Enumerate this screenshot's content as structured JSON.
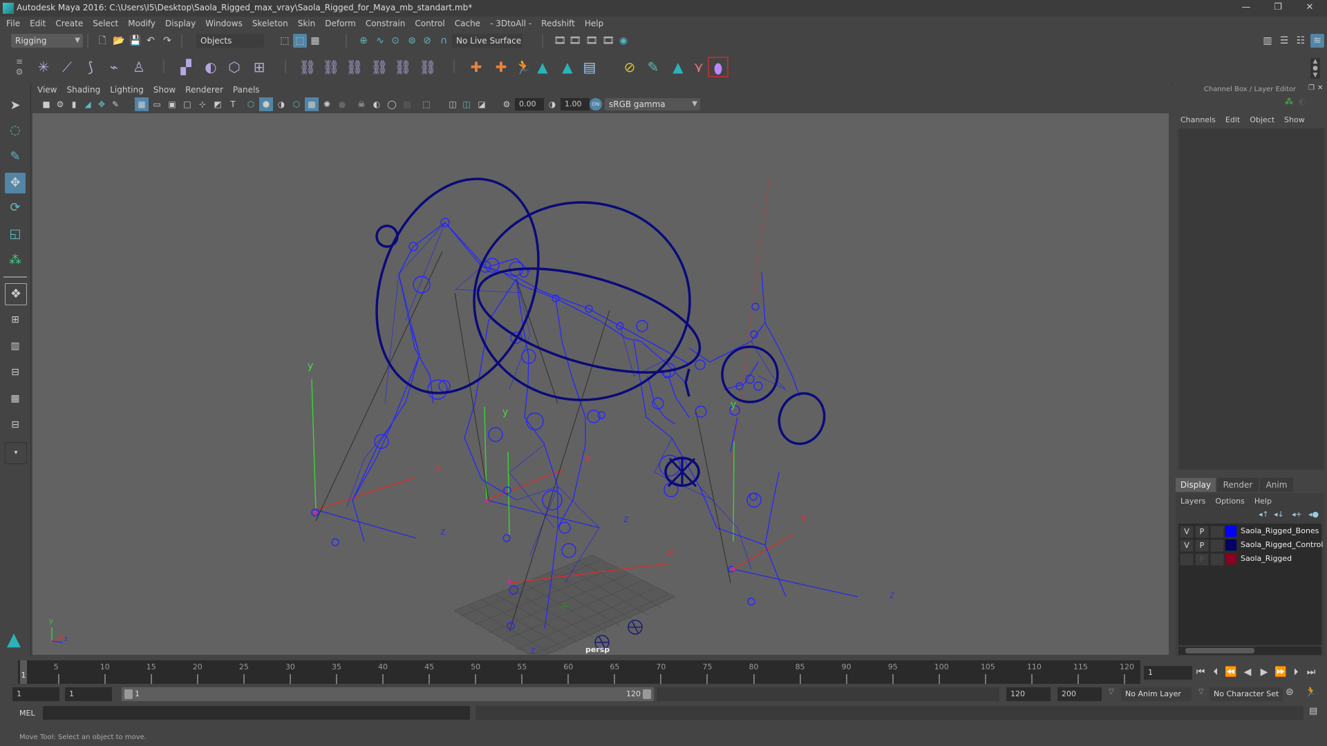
{
  "window": {
    "title": "Autodesk Maya 2016: C:\\Users\\I5\\Desktop\\Saola_Rigged_max_vray\\Saola_Rigged_for_Maya_mb_standart.mb*",
    "minimize": "—",
    "maximize": "❐",
    "close": "✕"
  },
  "menubar": [
    "File",
    "Edit",
    "Create",
    "Select",
    "Modify",
    "Display",
    "Windows",
    "Skeleton",
    "Skin",
    "Deform",
    "Constrain",
    "Control",
    "Cache",
    "- 3DtoAll -",
    "Redshift",
    "Help"
  ],
  "statusline": {
    "menuset": "Rigging",
    "selection_mode": "Objects",
    "live_surface": "No Live Surface"
  },
  "viewport": {
    "menus": [
      "View",
      "Shading",
      "Lighting",
      "Show",
      "Renderer",
      "Panels"
    ],
    "exposure": "0.00",
    "gamma": "1.00",
    "color_toggle": "ON",
    "color_space": "sRGB gamma",
    "camera_label": "persp",
    "axis_labels": {
      "x": "x",
      "y": "y",
      "z": "z"
    }
  },
  "channel_box": {
    "title": "Channel Box / Layer Editor",
    "menus": [
      "Channels",
      "Edit",
      "Object",
      "Show"
    ]
  },
  "layer_editor": {
    "tabs": [
      "Display",
      "Render",
      "Anim"
    ],
    "active_tab": "Display",
    "menus": [
      "Layers",
      "Options",
      "Help"
    ],
    "layers": [
      {
        "v": "V",
        "p": "P",
        "name": "Saola_Rigged_Bones",
        "color": "#0000ff"
      },
      {
        "v": "V",
        "p": "P",
        "name": "Saola_Rigged_Control",
        "color": "#000066"
      },
      {
        "v": "",
        "p": "P",
        "name": "Saola_Rigged",
        "color": "#8a0022"
      }
    ]
  },
  "timeline": {
    "start": 1,
    "end": 120,
    "current_frame": "1",
    "tick_labels": [
      "5",
      "10",
      "15",
      "20",
      "25",
      "30",
      "35",
      "40",
      "45",
      "50",
      "55",
      "60",
      "65",
      "70",
      "75",
      "80",
      "85",
      "90",
      "95",
      "100",
      "105",
      "110",
      "115",
      "120"
    ]
  },
  "range": {
    "start_time": "1",
    "playback_start": "1",
    "range_start_label": "1",
    "range_end_label": "120",
    "playback_end": "120",
    "end_time": "200",
    "anim_layer": "No Anim Layer",
    "character_set": "No Character Set"
  },
  "command_line": {
    "language": "MEL",
    "value": ""
  },
  "help_line": "Move Tool: Select an object to move.",
  "colors": {
    "accent": "#5285a6",
    "bones": "#1f1fff",
    "controls": "#0a0a7a",
    "viewport_bg": "#626262"
  }
}
